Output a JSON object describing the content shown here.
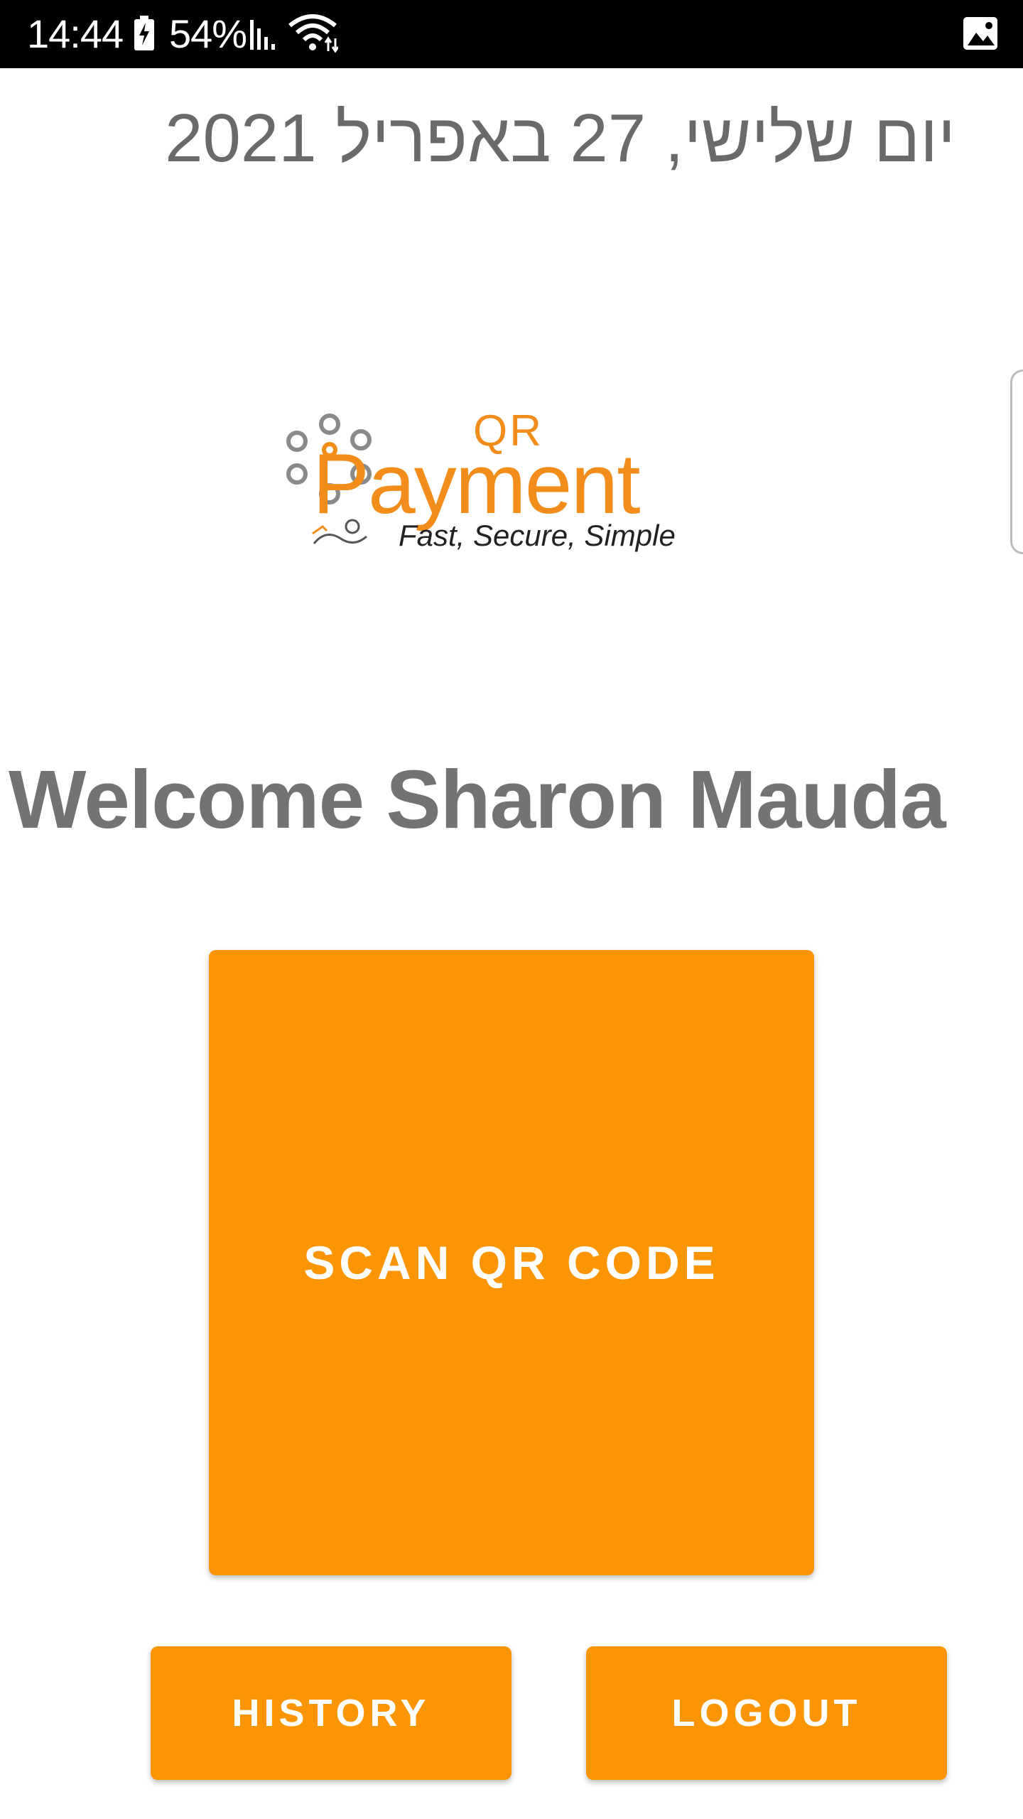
{
  "status_bar": {
    "time": "14:44",
    "battery_percent": "54%",
    "icons": [
      "battery-charging-icon",
      "signal-icon",
      "wifi-icon",
      "image-notification-icon"
    ]
  },
  "date": "יום שלישי, 27 באפריל 2021",
  "logo": {
    "qr_text": "QR",
    "word_text": "Payment",
    "tagline": "Fast, Secure, Simple",
    "brand_color": "#f28c1a"
  },
  "welcome_text": "Welcome Sharon Mauda",
  "buttons": {
    "scan_label": "SCAN QR CODE",
    "history_label": "HISTORY",
    "logout_label": "LOGOUT"
  },
  "colors": {
    "accent": "#fb9503",
    "text_gray": "#737373",
    "status_bar_bg": "#000000"
  }
}
